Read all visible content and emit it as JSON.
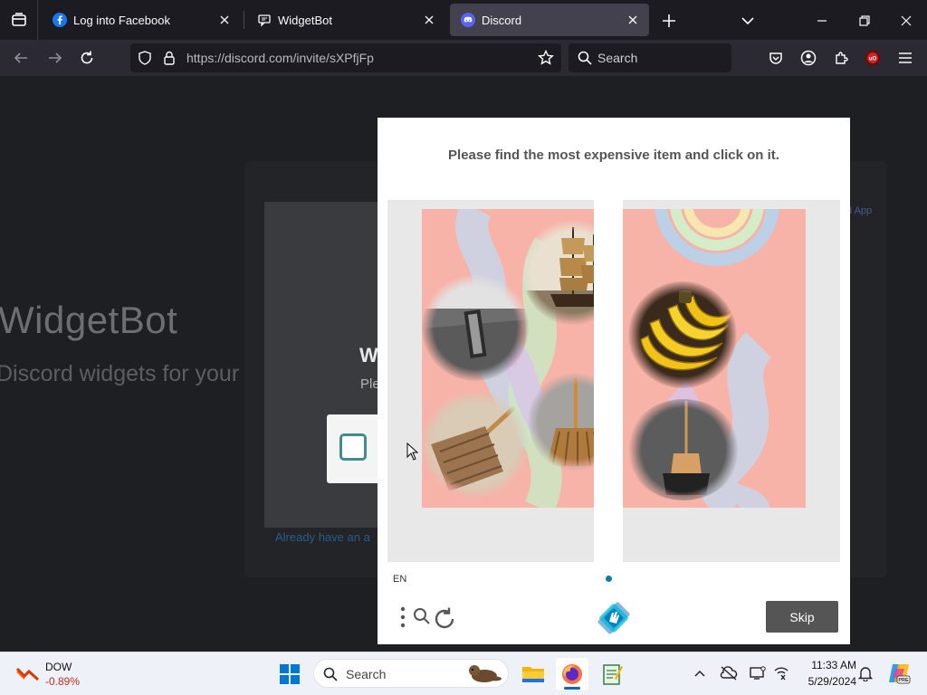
{
  "browser": {
    "tabs": [
      {
        "title": "Log into Facebook",
        "icon": "facebook-icon",
        "active": false
      },
      {
        "title": "WidgetBot",
        "icon": "chat-icon",
        "active": false
      },
      {
        "title": "Discord",
        "icon": "discord-icon",
        "active": true
      }
    ],
    "url": "https://discord.com/invite/sXPfjFp",
    "search_placeholder": "Search"
  },
  "page": {
    "title": "WidgetBot",
    "subtitle": "Discord widgets for your",
    "card_heading": "W",
    "card_text": "Ple",
    "link_text": "Already have an a",
    "app_link": "d App"
  },
  "captcha": {
    "prompt": "Please find the most expensive item and click on it.",
    "language": "EN",
    "skip_label": "Skip",
    "items_left": [
      "doorway-image",
      "sailing-ship-image",
      "broom-image",
      "broom-image-2"
    ],
    "items_right": [
      "bananas-image",
      "dustpan-image"
    ]
  },
  "taskbar": {
    "stock_name": "DOW",
    "stock_change": "-0.89%",
    "search_placeholder": "Search",
    "time": "11:33 AM",
    "date": "5/29/2024"
  },
  "colors": {
    "accent": "#0a7ea4",
    "collage_bg": "#f7b3a8",
    "skip_button": "#555555",
    "stock_negative": "#c42b1c"
  }
}
